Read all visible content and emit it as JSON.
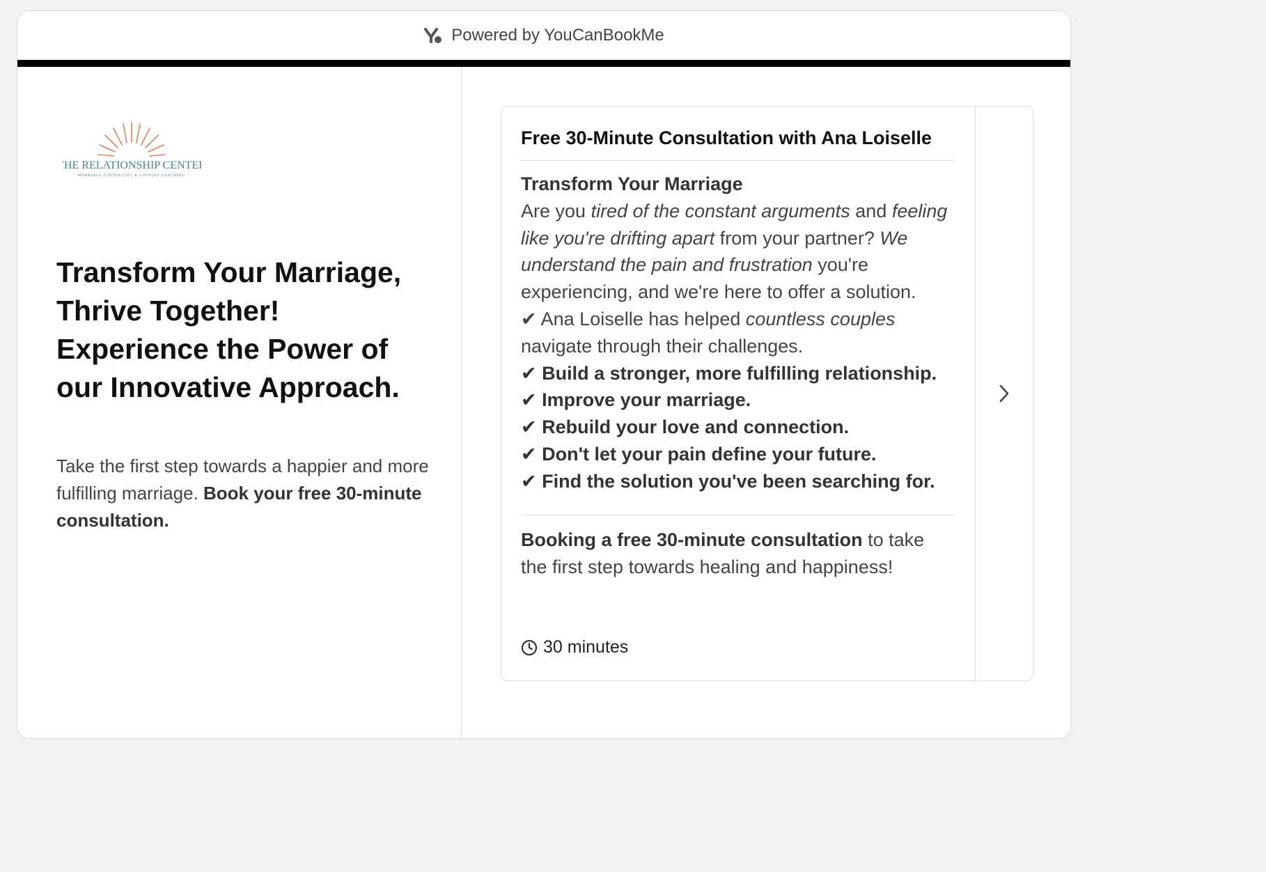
{
  "topbar": {
    "powered_by": "Powered by YouCanBookMe",
    "logo_icon": "youcanbookme-logo-icon"
  },
  "left": {
    "logo": {
      "name": "THE RELATIONSHIP CENTER",
      "tagline": "MARRIAGE COUNSELING & COUPLES COACHING"
    },
    "headline": [
      "Transform Your Marriage,",
      "Thrive Together!",
      "Experience the Power of",
      "our Innovative Approach."
    ],
    "intro_text": "Take the first step towards a happier and more fulfilling marriage. ",
    "intro_bold": "Book your free 30-minute consultation."
  },
  "card": {
    "title": "Free 30-Minute Consultation with Ana Loiselle",
    "section_heading": "Transform Your Marriage",
    "para": {
      "t1": "Are you ",
      "i1": "tired of the constant arguments",
      "t2": " and ",
      "i2": "feeling like you're drifting apart",
      "t3": " from your partner? ",
      "i3": "We understand the pain and frustration",
      "t4": " you're experiencing, and we're here to offer a solution."
    },
    "check1": {
      "t1": "✔ Ana Loiselle has helped ",
      "i1": "countless couples",
      "t2": " navigate through their challenges."
    },
    "bold_checks": [
      "✔ Build a stronger, more fulfilling relationship.",
      "✔ Improve your marriage.",
      "✔ Rebuild your love and connection.",
      "✔ Don't let your pain define your future.",
      "✔ Find the solution you've been searching for."
    ],
    "booking_bold": "Booking a free 30-minute consultation",
    "booking_text": " to take the first step towards healing and happiness!",
    "duration": "30 minutes",
    "duration_icon": "clock-icon",
    "next_icon": "chevron-right-icon"
  },
  "colors": {
    "accent_bar": "#000000",
    "logo_rays": "#d9825f",
    "logo_text": "#4a7f8c"
  }
}
